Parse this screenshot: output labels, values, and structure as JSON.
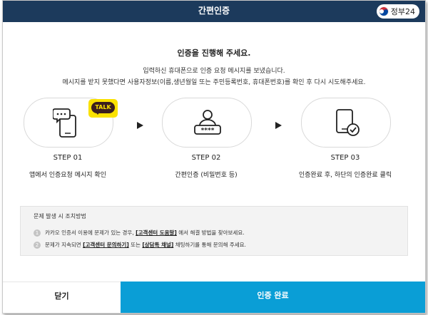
{
  "header": {
    "title": "간편인증",
    "gov_logo_text": "정부24"
  },
  "main": {
    "title": "인증을 진행해 주세요.",
    "desc_line1": "입력하신 휴대폰으로 인증 요청 메시지를 보냈습니다.",
    "desc_line2": "메시지를 받지 못했다면 사용자정보(이름,생년월일 또는 주민등록번호, 휴대폰번호)를 확인 후 다시 시도해주세요.",
    "talk_badge": "TALK"
  },
  "steps": [
    {
      "label": "STEP 01",
      "caption": "앱에서 인증요청 메시지 확인",
      "icon": "phone-message-icon"
    },
    {
      "label": "STEP 02",
      "caption": "간편인증 (비밀번호 등)",
      "icon": "user-password-icon"
    },
    {
      "label": "STEP 03",
      "caption": "인증완료 후, 하단의 인증완료 클릭",
      "icon": "phone-check-icon"
    }
  ],
  "trouble": {
    "title": "문제 발생 시 조치방법",
    "items": [
      {
        "num": "1",
        "pre": "카카오 인증서 이용에 문제가 있는 경우,",
        "link1": "[고객센터 도움말]",
        "post": "에서 해결 방법을 찾아보세요."
      },
      {
        "num": "2",
        "pre": "문제가 지속되면",
        "link1": "[고객센터 문의하기]",
        "mid": "또는",
        "link2": "[상담톡 채널]",
        "post": "채팅하기를 통해 문의해 주세요."
      }
    ]
  },
  "buttons": {
    "close": "닫기",
    "confirm": "인증 완료"
  },
  "colors": {
    "header_bg": "#1c3a5c",
    "confirm_bg": "#0a9ed6",
    "talk_yellow": "#fae100"
  }
}
